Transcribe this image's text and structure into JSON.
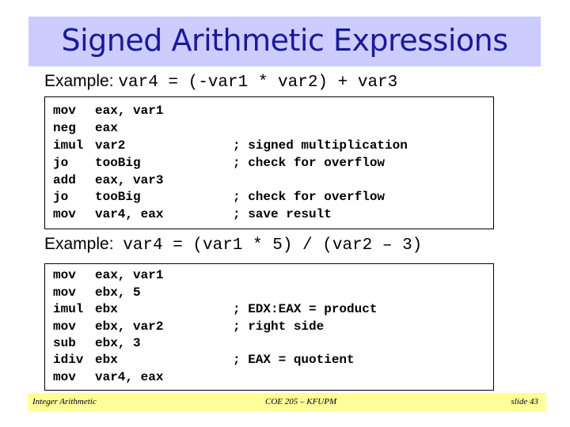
{
  "title": "Signed Arithmetic Expressions",
  "examples": [
    {
      "label": "Example:",
      "expression": "var4 = (-var1 * var2) + var3",
      "code": [
        {
          "op": "mov",
          "args": "eax, var1",
          "comment": ""
        },
        {
          "op": "neg",
          "args": "eax",
          "comment": ""
        },
        {
          "op": "imul",
          "args": "var2",
          "comment": "; signed multiplication"
        },
        {
          "op": "jo",
          "args": "tooBig",
          "comment": "; check for overflow"
        },
        {
          "op": "add",
          "args": "eax, var3",
          "comment": ""
        },
        {
          "op": "jo",
          "args": "tooBig",
          "comment": "; check for overflow"
        },
        {
          "op": "mov",
          "args": "var4, eax",
          "comment": "; save result"
        }
      ]
    },
    {
      "label": "Example:",
      "expression": "var4 = (var1 * 5) / (var2 – 3)",
      "code": [
        {
          "op": "mov",
          "args": "eax, var1",
          "comment": ""
        },
        {
          "op": "mov",
          "args": "ebx, 5",
          "comment": ""
        },
        {
          "op": "imul",
          "args": "ebx",
          "comment": "; EDX:EAX = product"
        },
        {
          "op": "mov",
          "args": "ebx, var2",
          "comment": "; right side"
        },
        {
          "op": "sub",
          "args": "ebx, 3",
          "comment": ""
        },
        {
          "op": "idiv",
          "args": "ebx",
          "comment": "; EAX = quotient"
        },
        {
          "op": "mov",
          "args": "var4, eax",
          "comment": ""
        }
      ]
    }
  ],
  "footer": {
    "left": "Integer Arithmetic",
    "center": "COE 205 – KFUPM",
    "right": "slide 43"
  },
  "colors": {
    "title_bg": "#ccccff",
    "title_text": "#1a1a99",
    "footer_bg": "#ffff99"
  }
}
